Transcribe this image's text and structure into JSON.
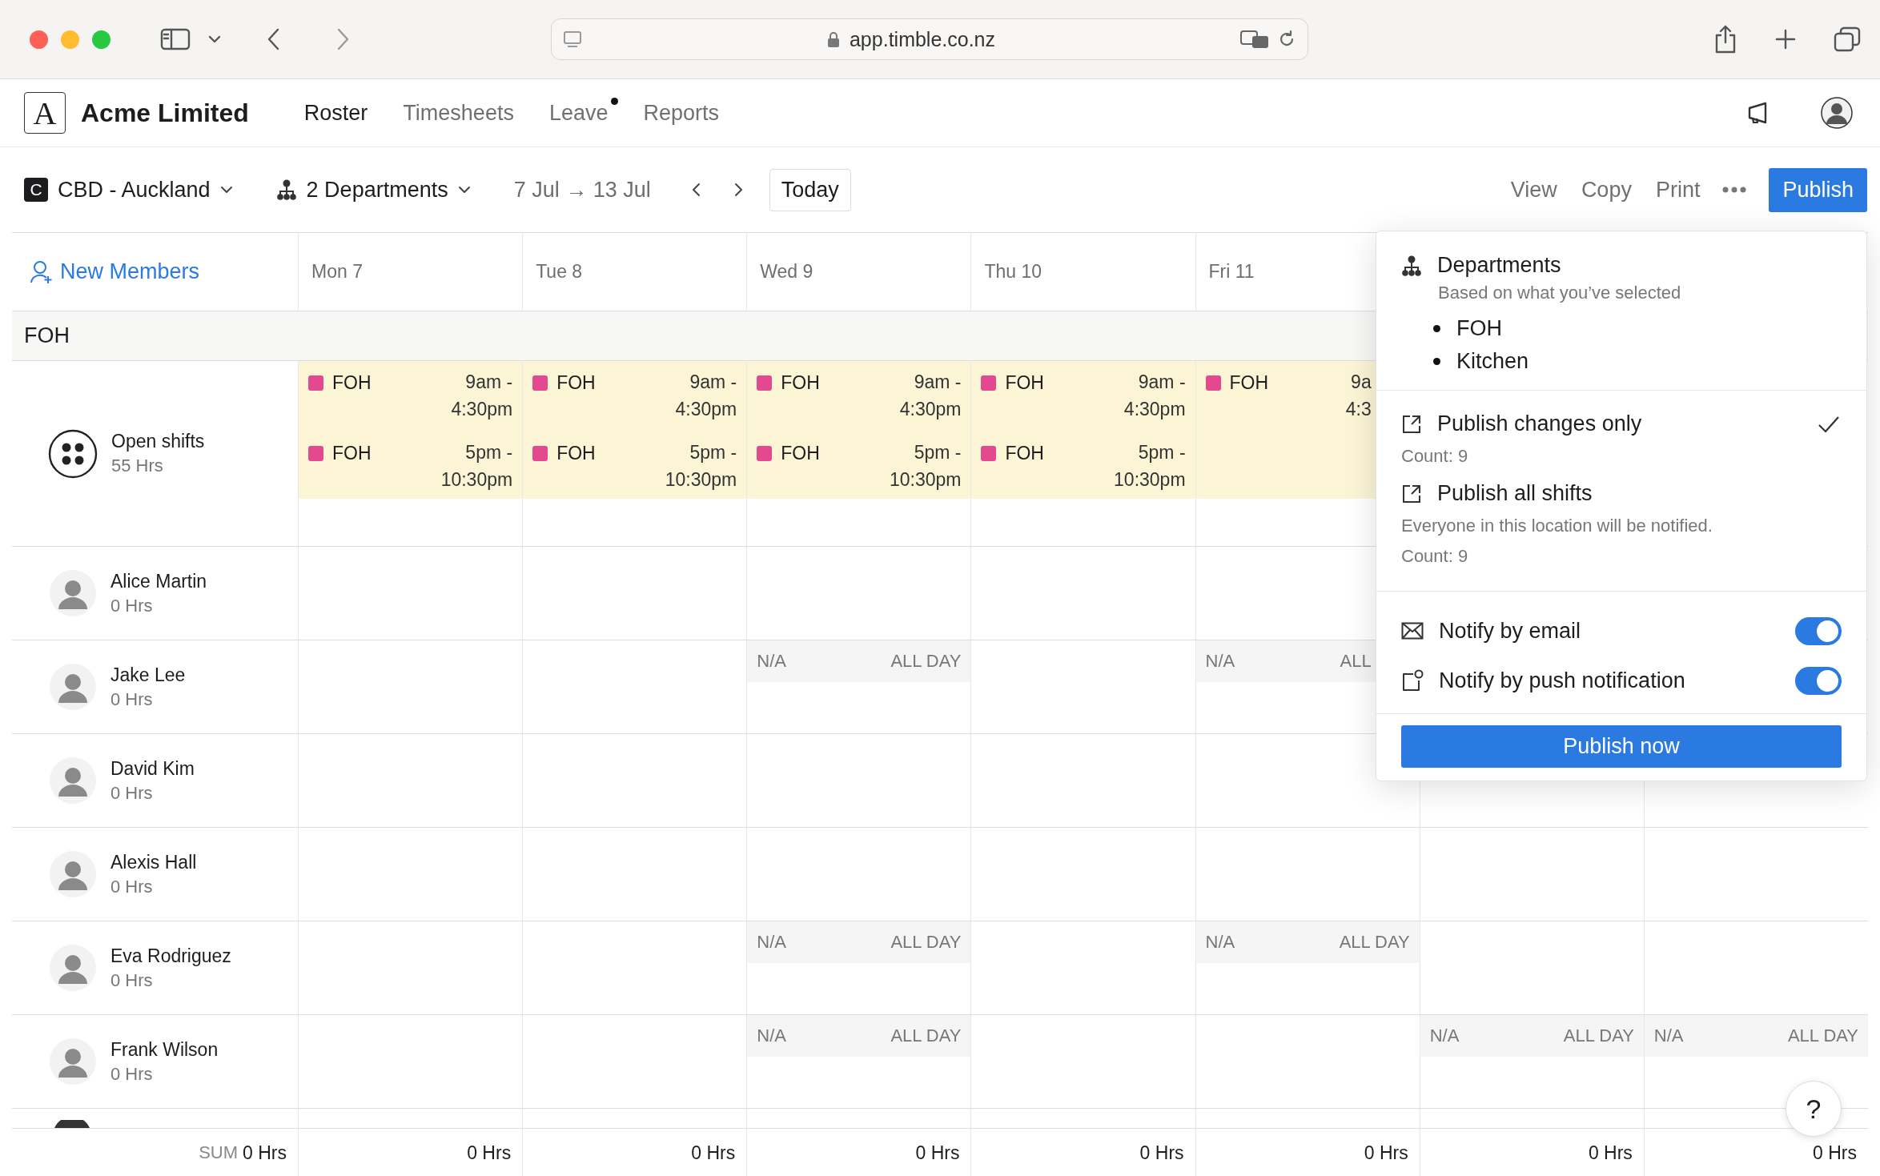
{
  "browser": {
    "url": "app.timble.co.nz"
  },
  "app": {
    "logo": "A",
    "company": "Acme Limited",
    "nav": [
      {
        "label": "Roster",
        "selected": true,
        "badge": false
      },
      {
        "label": "Timesheets",
        "selected": false,
        "badge": false
      },
      {
        "label": "Leave",
        "selected": false,
        "badge": true
      },
      {
        "label": "Reports",
        "selected": false,
        "badge": false
      }
    ]
  },
  "toolbar": {
    "location_badge": "C",
    "location": "CBD - Auckland",
    "departments": "2 Departments",
    "date_range": "7 Jul → 13 Jul",
    "today": "Today",
    "actions": [
      "View",
      "Copy",
      "Print"
    ],
    "publish": "Publish"
  },
  "roster": {
    "new_members": "New Members",
    "days": [
      "Mon 7",
      "Tue 8",
      "Wed 9",
      "Thu 10",
      "Fri 11"
    ],
    "group": "FOH",
    "rows": [
      {
        "kind": "open",
        "name": "Open shifts",
        "hours": "55 Hrs",
        "cells": [
          {
            "shifts": [
              {
                "dept": "FOH",
                "color": "#e4488f",
                "time": [
                  "9am -",
                  "4:30pm"
                ]
              },
              {
                "dept": "FOH",
                "color": "#e4488f",
                "time": [
                  "5pm -",
                  "10:30pm"
                ]
              }
            ]
          },
          {
            "shifts": [
              {
                "dept": "FOH",
                "color": "#e4488f",
                "time": [
                  "9am -",
                  "4:30pm"
                ]
              },
              {
                "dept": "FOH",
                "color": "#e4488f",
                "time": [
                  "5pm -",
                  "10:30pm"
                ]
              }
            ]
          },
          {
            "shifts": [
              {
                "dept": "FOH",
                "color": "#e4488f",
                "time": [
                  "9am -",
                  "4:30pm"
                ]
              },
              {
                "dept": "FOH",
                "color": "#e4488f",
                "time": [
                  "5pm -",
                  "10:30pm"
                ]
              }
            ]
          },
          {
            "shifts": [
              {
                "dept": "FOH",
                "color": "#e4488f",
                "time": [
                  "9am -",
                  "4:30pm"
                ]
              },
              {
                "dept": "FOH",
                "color": "#e4488f",
                "time": [
                  "5pm -",
                  "10:30pm"
                ]
              }
            ]
          },
          {
            "shifts": [
              {
                "dept": "FOH",
                "color": "#e4488f",
                "time": [
                  "9a",
                  "4:3"
                ]
              }
            ]
          },
          null,
          null
        ]
      },
      {
        "kind": "person",
        "name": "Alice Martin",
        "hours": "0 Hrs",
        "cells": [
          null,
          null,
          null,
          null,
          null,
          null,
          null
        ]
      },
      {
        "kind": "person",
        "name": "Jake Lee",
        "hours": "0 Hrs",
        "cells": [
          null,
          null,
          {
            "label": "N/A",
            "time": "ALL DAY"
          },
          null,
          {
            "label": "N/A",
            "time": "ALL"
          },
          null,
          null
        ]
      },
      {
        "kind": "person",
        "name": "David Kim",
        "hours": "0 Hrs",
        "cells": [
          null,
          null,
          null,
          null,
          null,
          null,
          null
        ]
      },
      {
        "kind": "person",
        "name": "Alexis Hall",
        "hours": "0 Hrs",
        "cells": [
          null,
          null,
          null,
          null,
          null,
          null,
          null
        ]
      },
      {
        "kind": "person",
        "name": "Eva Rodriguez",
        "hours": "0 Hrs",
        "cells": [
          null,
          null,
          {
            "label": "N/A",
            "time": "ALL DAY"
          },
          null,
          {
            "label": "N/A",
            "time": "ALL DAY"
          },
          null,
          null
        ]
      },
      {
        "kind": "person",
        "name": "Frank Wilson",
        "hours": "0 Hrs",
        "cells": [
          null,
          null,
          {
            "label": "N/A",
            "time": "ALL DAY"
          },
          null,
          null,
          {
            "label": "N/A",
            "time": "ALL DAY"
          },
          {
            "label": "N/A",
            "time": "ALL DAY"
          }
        ]
      }
    ],
    "footer": {
      "sum_label": "SUM",
      "total": "0 Hrs",
      "day_totals": [
        "0 Hrs",
        "0 Hrs",
        "0 Hrs",
        "0 Hrs",
        "0 Hrs",
        "0 Hrs",
        "0 Hrs"
      ]
    }
  },
  "publish_popup": {
    "departments": {
      "title": "Departments",
      "subtitle": "Based on what you’ve selected",
      "items": [
        "FOH",
        "Kitchen"
      ]
    },
    "options": [
      {
        "label": "Publish changes only",
        "count": "Count: 9",
        "selected": true
      },
      {
        "label": "Publish all shifts",
        "note": "Everyone in this location will be notified.",
        "count": "Count: 9",
        "selected": false
      }
    ],
    "notify": [
      {
        "kind": "email",
        "label": "Notify by email",
        "on": true
      },
      {
        "kind": "push",
        "label": "Notify by push notification",
        "on": true
      }
    ],
    "button": "Publish now"
  },
  "help": "?"
}
